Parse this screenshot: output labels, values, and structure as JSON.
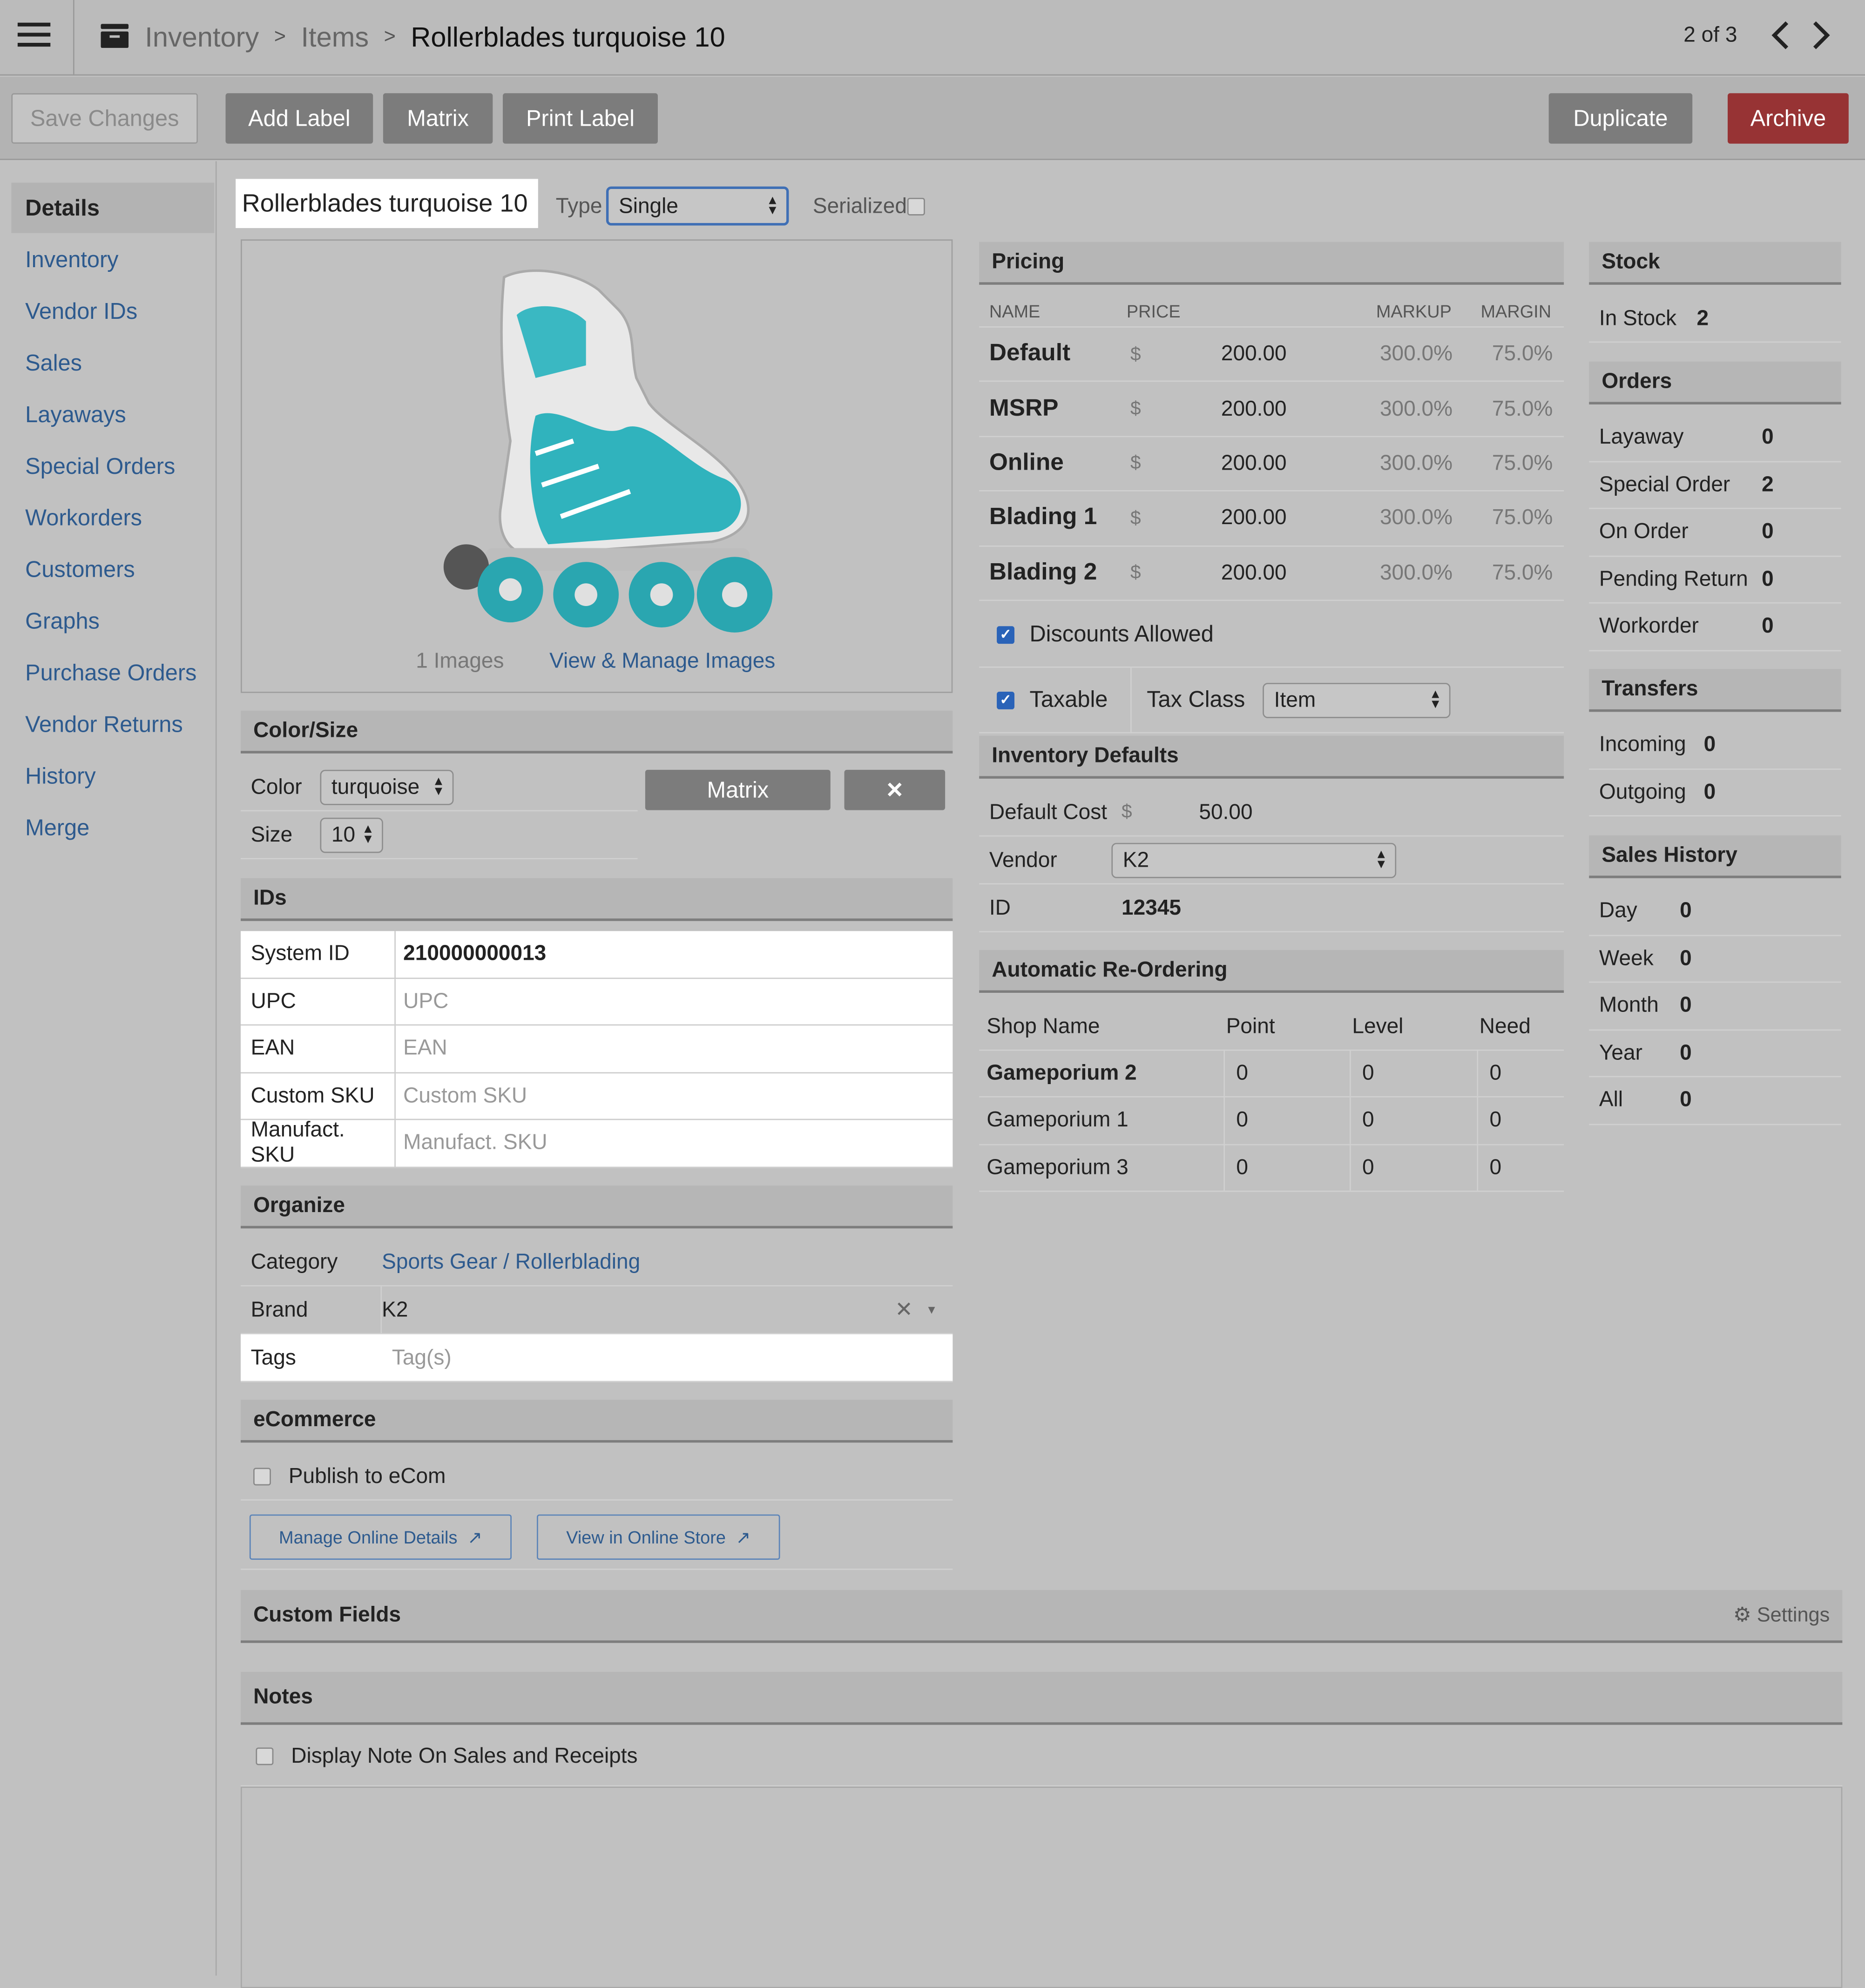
{
  "topbar": {
    "breadcrumb": [
      "Inventory",
      "Items",
      "Rollerblades turquoise 10"
    ],
    "sep": ">",
    "pager": "2 of 3"
  },
  "toolbar": {
    "save": "Save Changes",
    "add_label": "Add Label",
    "matrix": "Matrix",
    "print_label": "Print Label",
    "duplicate": "Duplicate",
    "archive": "Archive"
  },
  "sidebar": [
    "Details",
    "Inventory",
    "Vendor IDs",
    "Sales",
    "Layaways",
    "Special Orders",
    "Workorders",
    "Customers",
    "Graphs",
    "Purchase Orders",
    "Vendor Returns",
    "History",
    "Merge"
  ],
  "item": {
    "name": "Rollerblades turquoise 10",
    "type_label": "Type",
    "type_value": "Single",
    "serialized_label": "Serialized"
  },
  "images": {
    "count": "1 Images",
    "manage": "View & Manage Images"
  },
  "color_size": {
    "title": "Color/Size",
    "color_label": "Color",
    "color_value": "turquoise",
    "size_label": "Size",
    "size_value": "10",
    "matrix": "Matrix",
    "remove": "×"
  },
  "ids": {
    "title": "IDs",
    "rows": [
      {
        "label": "System ID",
        "value": "210000000013",
        "placeholder": ""
      },
      {
        "label": "UPC",
        "value": "",
        "placeholder": "UPC"
      },
      {
        "label": "EAN",
        "value": "",
        "placeholder": "EAN"
      },
      {
        "label": "Custom SKU",
        "value": "",
        "placeholder": "Custom SKU"
      },
      {
        "label": "Manufact. SKU",
        "value": "",
        "placeholder": "Manufact. SKU"
      }
    ]
  },
  "organize": {
    "title": "Organize",
    "category_label": "Category",
    "category_value": "Sports Gear / Rollerblading",
    "brand_label": "Brand",
    "brand_value": "K2",
    "tags_label": "Tags",
    "tags_placeholder": "Tag(s)"
  },
  "ecommerce": {
    "title": "eCommerce",
    "publish": "Publish to eCom",
    "manage": "Manage Online Details",
    "view": "View in Online Store"
  },
  "pricing": {
    "title": "Pricing",
    "headers": [
      "NAME",
      "PRICE",
      "MARKUP",
      "MARGIN"
    ],
    "currency": "$",
    "rows": [
      {
        "name": "Default",
        "price": "200.00",
        "markup": "300.0%",
        "margin": "75.0%"
      },
      {
        "name": "MSRP",
        "price": "200.00",
        "markup": "300.0%",
        "margin": "75.0%"
      },
      {
        "name": "Online",
        "price": "200.00",
        "markup": "300.0%",
        "margin": "75.0%"
      },
      {
        "name": "Blading 1",
        "price": "200.00",
        "markup": "300.0%",
        "margin": "75.0%"
      },
      {
        "name": "Blading 2",
        "price": "200.00",
        "markup": "300.0%",
        "margin": "75.0%"
      }
    ],
    "discounts": "Discounts Allowed",
    "taxable": "Taxable",
    "tax_class_label": "Tax Class",
    "tax_class_value": "Item"
  },
  "inv_defaults": {
    "title": "Inventory Defaults",
    "cost_label": "Default Cost",
    "currency": "$",
    "cost_value": "50.00",
    "vendor_label": "Vendor",
    "vendor_value": "K2",
    "id_label": "ID",
    "id_value": "12345"
  },
  "reorder": {
    "title": "Automatic Re-Ordering",
    "headers": [
      "Shop Name",
      "Point",
      "Level",
      "Need"
    ],
    "rows": [
      {
        "shop": "Gameporium 2",
        "point": "0",
        "level": "0",
        "need": "0"
      },
      {
        "shop": "Gameporium 1",
        "point": "0",
        "level": "0",
        "need": "0"
      },
      {
        "shop": "Gameporium 3",
        "point": "0",
        "level": "0",
        "need": "0"
      }
    ]
  },
  "stock": {
    "title": "Stock",
    "label": "In Stock",
    "value": "2"
  },
  "orders": {
    "title": "Orders",
    "rows": [
      {
        "label": "Layaway",
        "value": "0"
      },
      {
        "label": "Special Order",
        "value": "2"
      },
      {
        "label": "On Order",
        "value": "0"
      },
      {
        "label": "Pending Return",
        "value": "0"
      },
      {
        "label": "Workorder",
        "value": "0"
      }
    ]
  },
  "transfers": {
    "title": "Transfers",
    "rows": [
      {
        "label": "Incoming",
        "value": "0"
      },
      {
        "label": "Outgoing",
        "value": "0"
      }
    ]
  },
  "sales_history": {
    "title": "Sales History",
    "rows": [
      {
        "label": "Day",
        "value": "0"
      },
      {
        "label": "Week",
        "value": "0"
      },
      {
        "label": "Month",
        "value": "0"
      },
      {
        "label": "Year",
        "value": "0"
      },
      {
        "label": "All",
        "value": "0"
      }
    ]
  },
  "custom_fields": {
    "title": "Custom Fields",
    "settings": "Settings"
  },
  "notes": {
    "title": "Notes",
    "display_note": "Display Note On Sales and Receipts"
  },
  "colors": {
    "archive": "#973334",
    "button": "#7c7c7c",
    "link": "#2d5a8e",
    "checkbox": "#2a63b8"
  }
}
